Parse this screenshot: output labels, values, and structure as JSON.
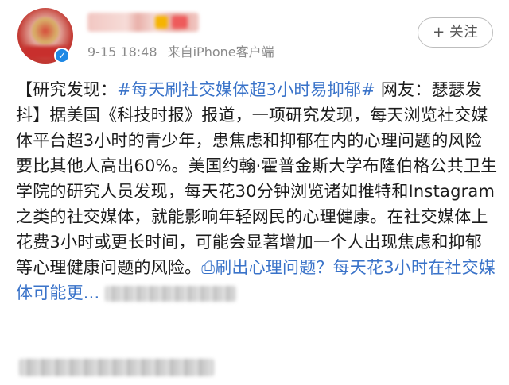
{
  "post": {
    "timestamp": "9-15 18:48",
    "source": "来自iPhone客户端",
    "follow_label": "+ 关注",
    "text_intro": "【研究发现：",
    "topic": "#每天刷社交媒体超3小时易抑郁#",
    "text_body": " 网友：瑟瑟发抖】据美国《科技时报》报道，一项研究发现，每天浏览社交媒体平台超3小时的青少年，患焦虑和抑郁在内的心理问题的风险要比其他人高出60%。美国约翰·霍普金斯大学布隆伯格公共卫生学院的研究人员发现，每天花30分钟浏览诸如推特和Instagram之类的社交媒体，就能影响年轻网民的心理健康。在社交媒体上花费3小时或更长时间，可能会显著增加一个人出现焦虑和抑郁等心理健康问题的风险。",
    "link_text": "刷出心理问题？每天花3小时在社交媒体可能更..."
  },
  "icons": {
    "verified": "verified-badge-icon",
    "link": "link-icon"
  }
}
